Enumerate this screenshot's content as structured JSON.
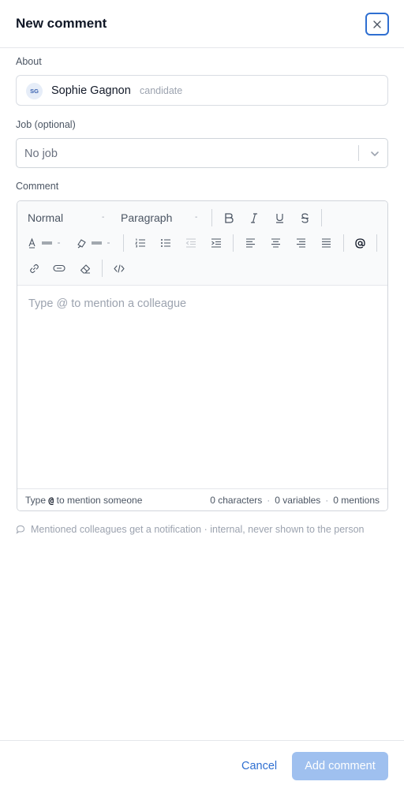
{
  "dialog": {
    "title": "New comment",
    "close_icon": "close-icon"
  },
  "about": {
    "label": "About",
    "avatar_initials": "SG",
    "name": "Sophie Gagnon",
    "role": "candidate"
  },
  "job": {
    "label": "Job (optional)",
    "value": "No job",
    "chevron_icon": "chevron-down-icon"
  },
  "comment": {
    "label": "Comment",
    "toolbar": {
      "font_size": "Normal",
      "block_type": "Paragraph",
      "bold_icon": "bold-icon",
      "italic_icon": "italic-icon",
      "underline_icon": "underline-icon",
      "strikethrough_icon": "strikethrough-icon",
      "text_color_icon": "text-color-icon",
      "highlight_icon": "highlight-icon",
      "ordered_list_icon": "ordered-list-icon",
      "bullet_list_icon": "bullet-list-icon",
      "outdent_icon": "outdent-icon",
      "indent_icon": "indent-icon",
      "align_left_icon": "align-left-icon",
      "align_center_icon": "align-center-icon",
      "align_right_icon": "align-right-icon",
      "align_justify_icon": "align-justify-icon",
      "mention_icon": "at-icon",
      "link_icon": "link-icon",
      "unlink_icon": "unlink-icon",
      "clear_format_icon": "eraser-icon",
      "code_icon": "code-icon"
    },
    "placeholder": "Type @ to mention a colleague",
    "status": {
      "hint_prefix": "Type",
      "hint_key": "@",
      "hint_suffix": "to mention someone",
      "characters": "0 characters",
      "variables": "0 variables",
      "mentions": "0 mentions",
      "separator": "·"
    }
  },
  "notice": {
    "icon": "speech-bubble-icon",
    "text": "Mentioned colleagues get a notification · internal, never shown to the person"
  },
  "footer": {
    "cancel_label": "Cancel",
    "submit_label": "Add comment"
  },
  "colors": {
    "accent": "#2f6fd1",
    "submit_disabled": "#9fc0ef"
  }
}
